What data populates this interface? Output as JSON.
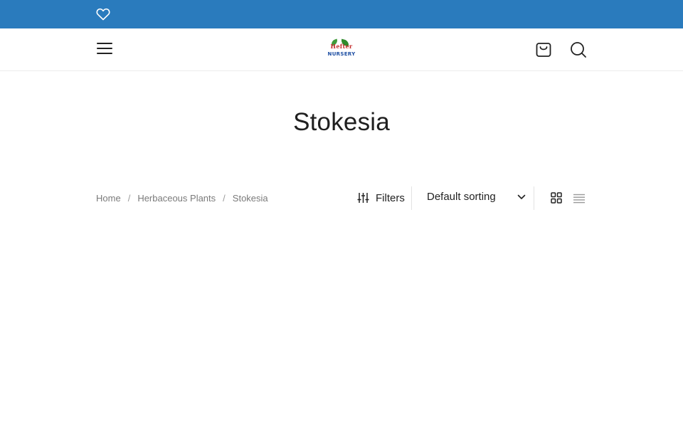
{
  "topbar": {
    "wishlist_icon": "heart-icon",
    "color": "#2a7bbd"
  },
  "header": {
    "menu_icon": "hamburger-icon",
    "logo": {
      "line1": "Hefter",
      "line2": "NURSERY"
    },
    "cart_icon": "shopping-bag-icon",
    "search_icon": "search-icon"
  },
  "page": {
    "title": "Stokesia"
  },
  "breadcrumb": {
    "items": [
      "Home",
      "Herbaceous Plants",
      "Stokesia"
    ],
    "separator": "/"
  },
  "toolbar": {
    "filters_label": "Filters",
    "filters_icon": "sliders-icon",
    "sort_selected": "Default sorting",
    "sort_icon": "chevron-down-icon",
    "grid_view_icon": "grid-view-icon",
    "list_view_icon": "list-view-icon"
  }
}
